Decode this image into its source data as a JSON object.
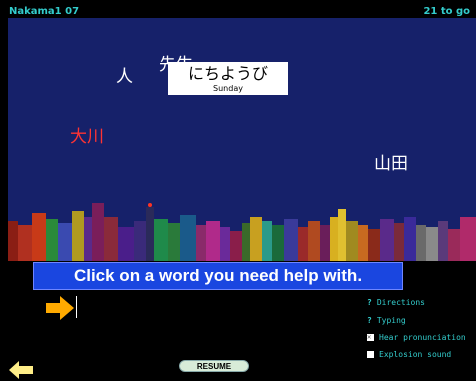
{
  "header": {
    "title": "Nakama1 07",
    "progress": "21 to go"
  },
  "words": [
    {
      "text": "人",
      "color": "#ffffff"
    },
    {
      "text": "先生",
      "color": "#ffffff"
    },
    {
      "text": "大川",
      "color": "#ff3333"
    },
    {
      "text": "山田",
      "color": "#ffffff"
    }
  ],
  "flashcard": {
    "kana": "にちようび",
    "english": "Sunday"
  },
  "banner": {
    "text": "Click on a word you need help with."
  },
  "answer": {
    "value": ""
  },
  "options": {
    "directions": "Directions",
    "typing": "Typing",
    "hear": "Hear pronunciation",
    "hear_checked": true,
    "explosion": "Explosion sound",
    "explosion_checked": false
  },
  "buttons": {
    "resume": "RESUME"
  },
  "colors": {
    "sky": "#16216a",
    "banner": "#1a46e0",
    "cyan": "#33cccc",
    "arrow": "#ffaa00",
    "back_arrow": "#ffee88"
  },
  "icons": {
    "answer_arrow": "right-arrow-icon",
    "back": "left-arrow-icon"
  }
}
